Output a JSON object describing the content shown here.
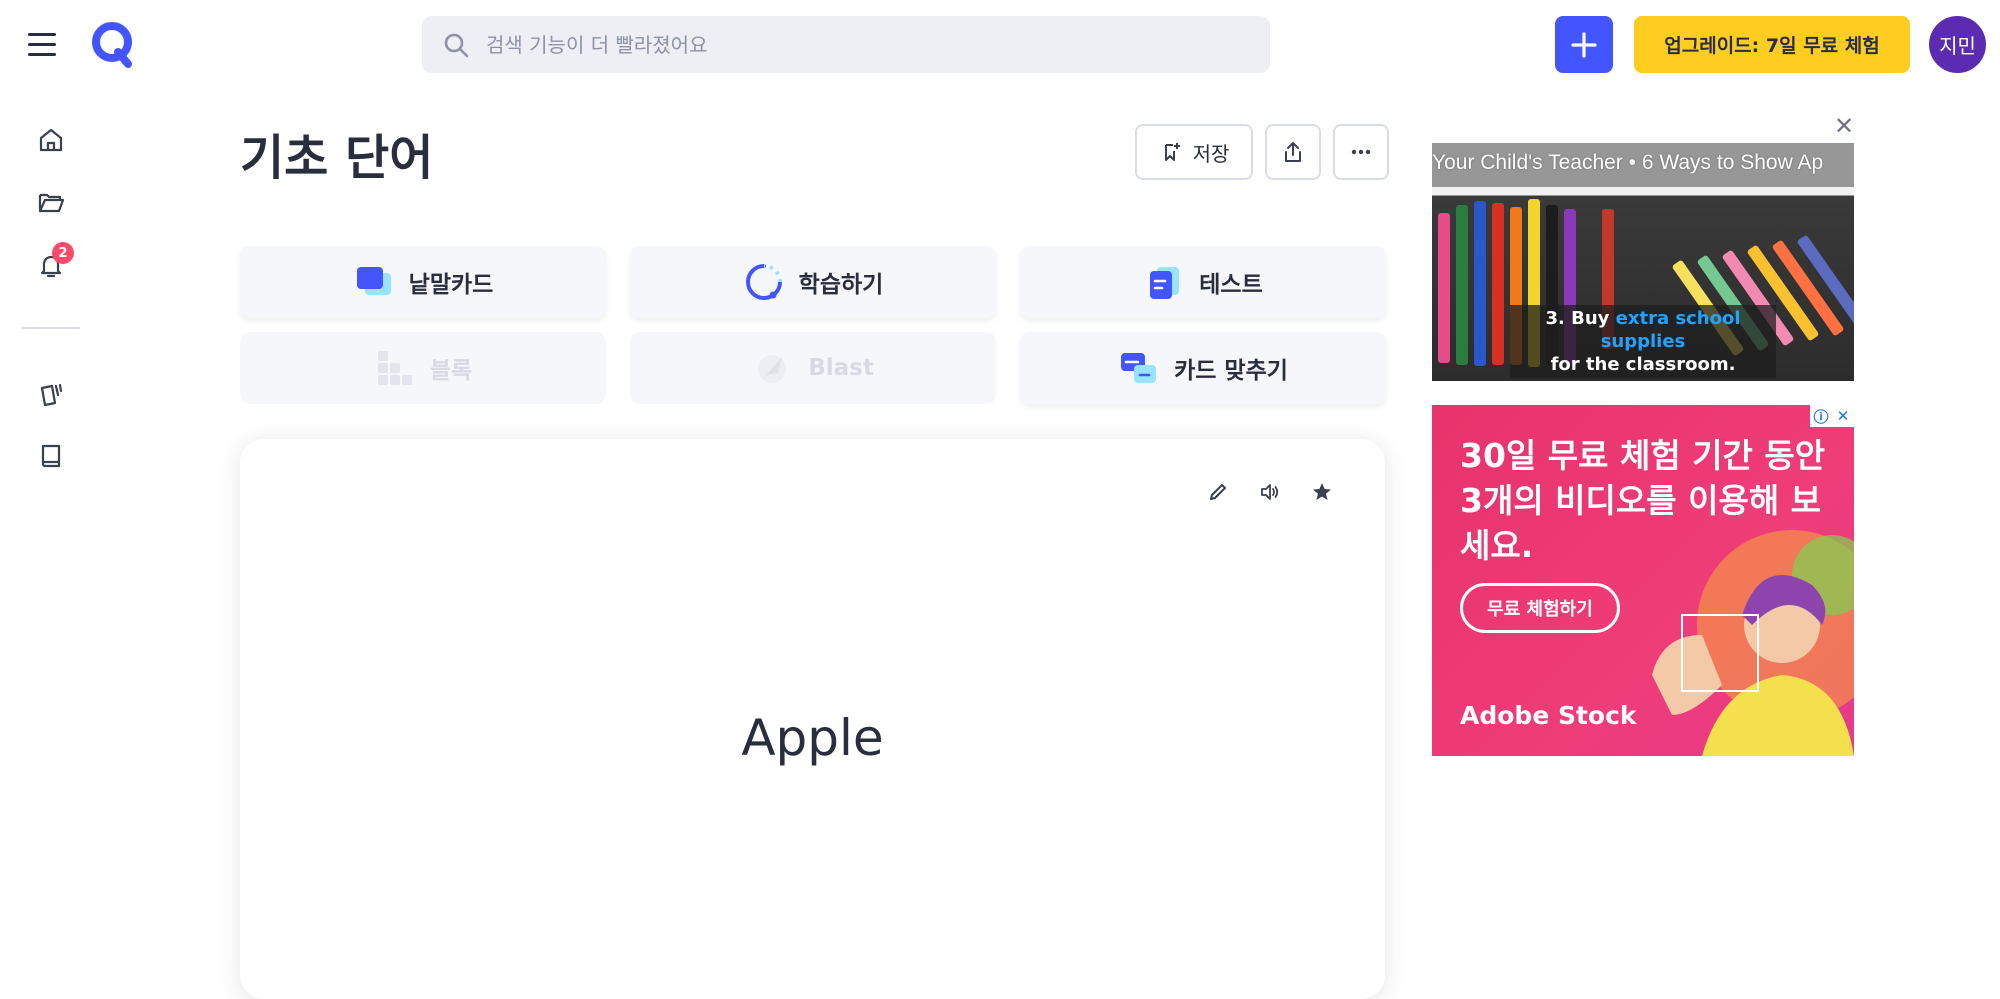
{
  "header": {
    "search_placeholder": "검색 기능이 더 빨라졌어요",
    "upgrade_label": "업그레이드: 7일 무료 체험",
    "avatar_text": "지민",
    "accent_color": "#4255ff",
    "upgrade_color": "#ffcd1f"
  },
  "sidenav": {
    "notification_count": "2",
    "items": [
      "home-icon",
      "folder-icon",
      "bell-icon",
      "flashcard-sets-icon",
      "book-icon"
    ]
  },
  "set": {
    "title": "기초 단어",
    "save_label": "저장"
  },
  "modes": [
    {
      "label": "낱말카드",
      "enabled": true
    },
    {
      "label": "학습하기",
      "enabled": true
    },
    {
      "label": "테스트",
      "enabled": true
    },
    {
      "label": "블록",
      "enabled": false
    },
    {
      "label": "Blast",
      "enabled": false
    },
    {
      "label": "카드 맞추기",
      "enabled": true
    }
  ],
  "card": {
    "term": "Apple"
  },
  "ads": {
    "ad1_ticker": "Your Child's Teacher  •  6 Ways to Show Ap",
    "ad1_caption_num": "3. Buy ",
    "ad1_caption_hl": "extra school supplies",
    "ad1_caption_rest": "for the classroom.",
    "ad2_text": "30일 무료 체험 기간 동안 3개의 비디오를 이용해 보세요.",
    "ad2_button": "무료 체험하기",
    "ad2_brand": "Adobe Stock"
  }
}
